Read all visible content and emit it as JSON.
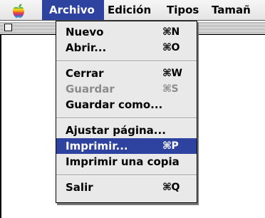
{
  "menubar": {
    "apple_icon": "apple-icon",
    "menus": [
      {
        "label": "Archivo",
        "active": true
      },
      {
        "label": "Edición"
      },
      {
        "label": "Tipos"
      },
      {
        "label": "Tamañ"
      }
    ]
  },
  "window": {
    "close_icon": "close-box-icon"
  },
  "file_menu": {
    "items": [
      {
        "label": "Nuevo",
        "shortcut": "⌘N",
        "enabled": true
      },
      {
        "label": "Abrir...",
        "shortcut": "⌘O",
        "enabled": true
      },
      {
        "label": "Cerrar",
        "shortcut": "⌘W",
        "enabled": true
      },
      {
        "label": "Guardar",
        "shortcut": "⌘S",
        "enabled": false
      },
      {
        "label": "Guardar como...",
        "shortcut": "",
        "enabled": true
      },
      {
        "label": "Ajustar página...",
        "shortcut": "",
        "enabled": true
      },
      {
        "label": "Imprimir...",
        "shortcut": "⌘P",
        "enabled": true,
        "selected": true
      },
      {
        "label": "Imprimir una copia",
        "shortcut": "",
        "enabled": true
      },
      {
        "label": "Salir",
        "shortcut": "⌘Q",
        "enabled": true
      }
    ]
  },
  "colors": {
    "highlight": "#2e42a0",
    "menu_background": "#e9e9e9",
    "disabled_text": "#8c8c8c"
  }
}
